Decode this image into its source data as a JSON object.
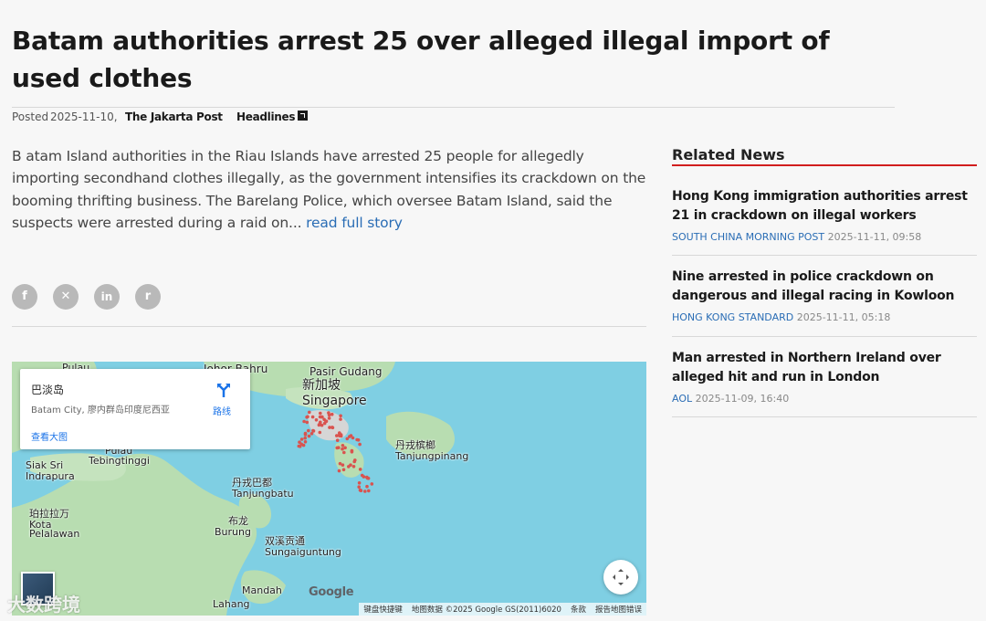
{
  "article": {
    "title": "Batam authorities arrest 25 over alleged illegal import of used clothes",
    "posted_label": "Posted",
    "posted_date": "2025-11-10,",
    "source": "The Jakarta Post",
    "tag": "Headlines",
    "summary": "B atam Island authorities in the Riau Islands have arrested 25 people for allegedly importing secondhand clothes illegally, as the government intensifies its crackdown on the booming thrifting business. The Barelang Police, which oversee Batam Island, said the suspects were arrested during a raid on...",
    "read_more": "read full story"
  },
  "share": {
    "facebook": "f",
    "x": "✕",
    "linkedin": "in",
    "reddit": "r"
  },
  "map": {
    "card": {
      "name": "巴淡岛",
      "address": "Batam City, 廖内群岛印度尼西亚",
      "route": "路线",
      "view_larger": "查看大图"
    },
    "places": {
      "johor_bahru": "Johor Bahru",
      "pulau": "Pulau",
      "pasir_gudang": "Pasir Gudang",
      "singapore_cn": "新加坡",
      "singapore": "Singapore",
      "tanjungpinang_cn": "丹戎槟榔",
      "tanjungpinang": "Tanjungpinang",
      "pulau_tebingtinggi_1": "Pulau",
      "pulau_tebingtinggi_2": "Tebingtinggi",
      "siak_sri_indrapura_1": "Siak Sri",
      "siak_sri_indrapura_2": "Indrapura",
      "tanjungbatu_cn": "丹戎巴都",
      "tanjungbatu": "Tanjungbatu",
      "kota_pelalawan_cn": "珀拉拉万",
      "kota_pelalawan_1": "Kota",
      "kota_pelalawan_2": "Pelalawan",
      "burung_cn": "布龙",
      "burung": "Burung",
      "sungaiguntung_cn": "双溪贡通",
      "sungaiguntung": "Sungaiguntung",
      "mandah": "Mandah",
      "lahang": "Lahang"
    },
    "google": "Google",
    "footer": [
      "键盘快捷键",
      "地图数据 ©2025 Google GS(2011)6020",
      "条款",
      "报告地图错误"
    ],
    "colors": {
      "water": "#7fcfe3",
      "land": "#b8ddb1",
      "pin": "#d9534f"
    }
  },
  "watermark": "大数跨境",
  "related": {
    "title": "Related News",
    "items": [
      {
        "headline": "Hong Kong immigration authorities arrest 21 in crackdown on illegal workers",
        "source": "SOUTH CHINA MORNING POST",
        "time": "2025-11-11, 09:58"
      },
      {
        "headline": "Nine arrested in police crackdown on dangerous and illegal racing in Kowloon",
        "source": "HONG KONG STANDARD",
        "time": "2025-11-11, 05:18"
      },
      {
        "headline": "Man arrested in Northern Ireland over alleged hit and run in London",
        "source": "AOL",
        "time": "2025-11-09, 16:40"
      }
    ],
    "accent": "#d11e1e"
  }
}
